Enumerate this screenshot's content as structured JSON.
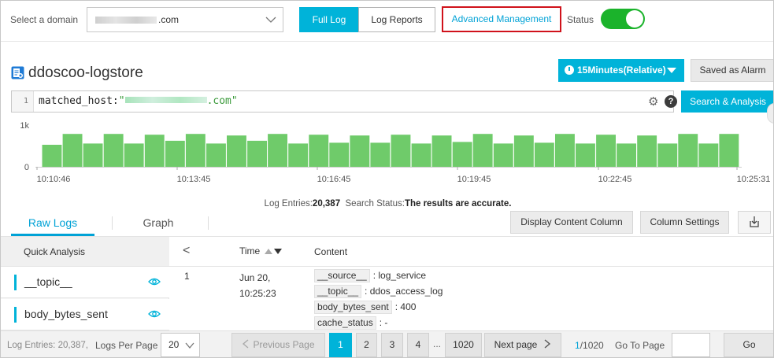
{
  "topbar": {
    "domain_label": "Select a domain",
    "domain_value_suffix": ".com",
    "full_log": "Full Log",
    "log_reports": "Log Reports",
    "advanced_management": "Advanced Management",
    "status_label": "Status",
    "status_on": true
  },
  "logstore": {
    "title": "ddoscoo-logstore",
    "time_range": "15Minutes(Relative)",
    "saved_as_alarm": "Saved as Alarm"
  },
  "query": {
    "line_number": "1",
    "prefix": "matched_host:",
    "quote_open": "\"",
    "value_suffix": ".com\"",
    "search_button": "Search & Analysis"
  },
  "histogram": {
    "y_ticks": [
      "1k",
      "0"
    ],
    "x_ticks": [
      "10:10:46",
      "10:13:45",
      "10:16:45",
      "10:19:45",
      "10:22:45",
      "10:25:31"
    ],
    "bar_color": "#6fcb6a",
    "values": [
      0.55,
      0.82,
      0.58,
      0.82,
      0.58,
      0.8,
      0.65,
      0.82,
      0.58,
      0.78,
      0.65,
      0.82,
      0.58,
      0.8,
      0.6,
      0.78,
      0.6,
      0.8,
      0.58,
      0.78,
      0.62,
      0.82,
      0.58,
      0.78,
      0.6,
      0.82,
      0.58,
      0.8,
      0.58,
      0.78,
      0.58,
      0.82,
      0.58,
      0.82
    ]
  },
  "status_line": {
    "entries_label": "Log Entries:",
    "entries_value": "20,387",
    "status_label": "Search Status:",
    "status_value": "The results are accurate."
  },
  "tabs": {
    "raw_logs": "Raw Logs",
    "graph": "Graph",
    "display_content_column": "Display Content Column",
    "column_settings": "Column Settings"
  },
  "quick_analysis": {
    "title": "Quick Analysis",
    "fields": [
      "__topic__",
      "body_bytes_sent"
    ]
  },
  "table": {
    "chevron": "<",
    "time_header": "Time",
    "content_header": "Content",
    "rows": [
      {
        "index": "1",
        "time": "Jun 20, 10:25:23",
        "fields": [
          {
            "key": "__source__",
            "value": "log_service"
          },
          {
            "key": "__topic__",
            "value": "ddos_access_log"
          },
          {
            "key": "body_bytes_sent",
            "value": "400"
          },
          {
            "key": "cache_status",
            "value": "-"
          }
        ]
      }
    ]
  },
  "footer": {
    "entries": "Log Entries: 20,387",
    "sep": ",",
    "logs_per_page_label": "Logs Per Page",
    "logs_per_page_value": "20",
    "prev": "Previous Page",
    "pages": [
      "1",
      "2",
      "3",
      "4"
    ],
    "dots": "...",
    "last_page": "1020",
    "next": "Next page",
    "current_page": "1",
    "total_pages": "/1020",
    "goto_label": "Go To Page",
    "go": "Go"
  },
  "colors": {
    "accent": "#00b3d9",
    "link": "#00a2d6",
    "toggle_on": "#1bb32b",
    "highlight_box": "#d0121b"
  }
}
